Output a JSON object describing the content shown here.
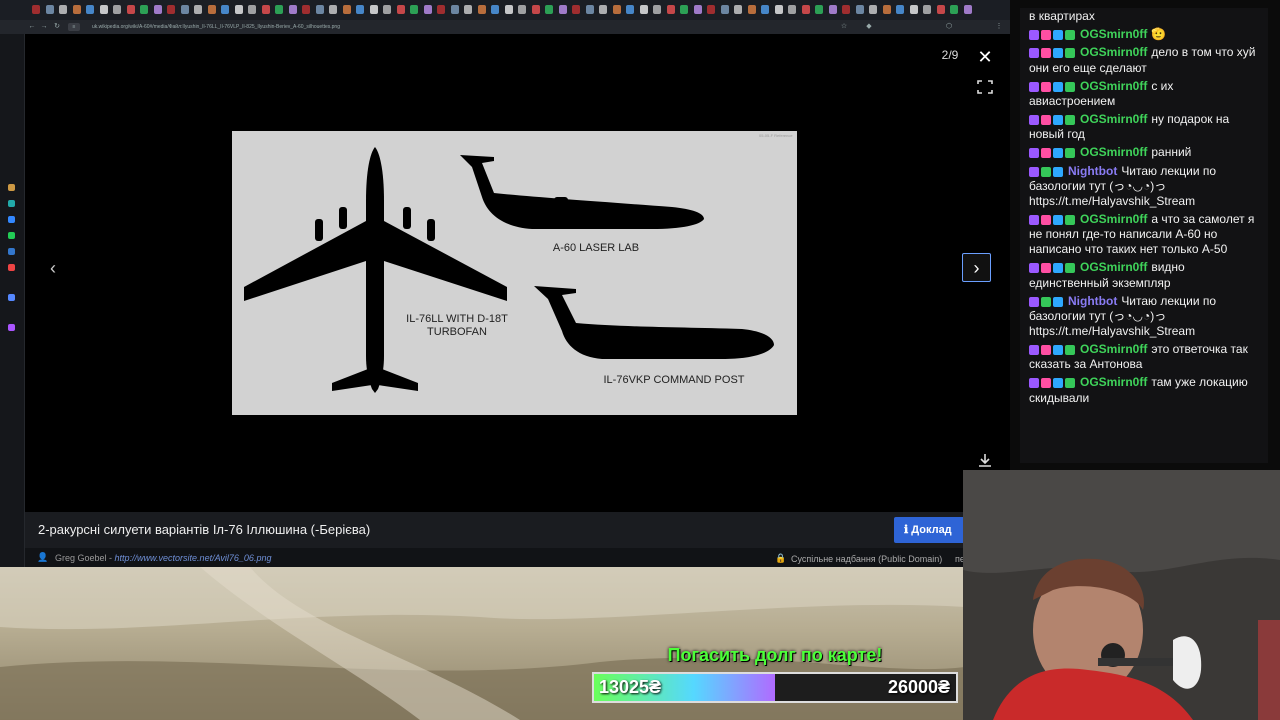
{
  "browser": {
    "url": "uk.wikipedia.org/wiki/А-60#/media/Файл:Ilyushin_Il-76LL_Il-76VLP_Il-825_Ilyushin-Beriev_A-60_silhouettes.png"
  },
  "viewer": {
    "counter": "2/9",
    "close_glyph": "✕",
    "prev_glyph": "‹",
    "next_glyph": "›",
    "image": {
      "stamp": "05-05-F Reference",
      "labels": {
        "il76ll": "IL-76LL WITH D-18T",
        "il76ll_line2": "TURBOFAN",
        "a60": "A-60 LASER LAB",
        "il76vkp": "IL-76VKP COMMAND POST"
      }
    },
    "caption": "2-ракурсні силуети варіантів Іл-76 Іллюшина (-Берієва)",
    "report_label": "Доклад",
    "author_name": "Greg Goebel - ",
    "author_link": "http://www.vectorsite.net/Avil76_06.png",
    "license": "Суспільне надбання (Public Domain)",
    "license_cut": "пе"
  },
  "donation": {
    "title": "Погасить долг по карте!",
    "current": "13025₴",
    "target": "26000₴",
    "progress": 0.501
  },
  "chat": {
    "colors": {
      "og": "#3fd35a",
      "nightbot": "#8a7cf5"
    },
    "messages": [
      {
        "user": "",
        "text": "в квартирах",
        "badges": []
      },
      {
        "user": "OGSmirn0ff",
        "text": "🫡",
        "badges": [
          "#9b59ff",
          "#ff4fa3",
          "#2ea8ff",
          "#35c759"
        ],
        "color": "og"
      },
      {
        "user": "OGSmirn0ff",
        "text": "дело в том что хуй они его еще сделают",
        "badges": [
          "#9b59ff",
          "#ff4fa3",
          "#2ea8ff",
          "#35c759"
        ],
        "color": "og"
      },
      {
        "user": "OGSmirn0ff",
        "text": "с их авиастроением",
        "badges": [
          "#9b59ff",
          "#ff4fa3",
          "#2ea8ff",
          "#35c759"
        ],
        "color": "og"
      },
      {
        "user": "OGSmirn0ff",
        "text": "ну подарок на новый год",
        "badges": [
          "#9b59ff",
          "#ff4fa3",
          "#2ea8ff",
          "#35c759"
        ],
        "color": "og"
      },
      {
        "user": "OGSmirn0ff",
        "text": "ранний",
        "badges": [
          "#9b59ff",
          "#ff4fa3",
          "#2ea8ff",
          "#35c759"
        ],
        "color": "og"
      },
      {
        "user": "Nightbot",
        "text": "Читаю лекции по базологии тут (っ◔◡◔)っ https://t.me/Halyavshik_Stream",
        "badges": [
          "#9b59ff",
          "#35c759",
          "#2ea8ff"
        ],
        "color": "nightbot"
      },
      {
        "user": "OGSmirn0ff",
        "text": "а что за самолет я не понял где-то написали А-60 но написано что таких нет только А-50",
        "badges": [
          "#9b59ff",
          "#ff4fa3",
          "#2ea8ff",
          "#35c759"
        ],
        "color": "og"
      },
      {
        "user": "OGSmirn0ff",
        "text": "видно единственный экземпляр",
        "badges": [
          "#9b59ff",
          "#ff4fa3",
          "#2ea8ff",
          "#35c759"
        ],
        "color": "og"
      },
      {
        "user": "Nightbot",
        "text": "Читаю лекции по базологии тут (っ◔◡◔)っ https://t.me/Halyavshik_Stream",
        "badges": [
          "#9b59ff",
          "#35c759",
          "#2ea8ff"
        ],
        "color": "nightbot"
      },
      {
        "user": "OGSmirn0ff",
        "text": "это ответочка так сказать за Антонова",
        "badges": [
          "#9b59ff",
          "#ff4fa3",
          "#2ea8ff",
          "#35c759"
        ],
        "color": "og"
      },
      {
        "user": "OGSmirn0ff",
        "text": "там уже локацию скидывали",
        "badges": [
          "#9b59ff",
          "#ff4fa3",
          "#2ea8ff",
          "#35c759"
        ],
        "color": "og"
      }
    ]
  }
}
